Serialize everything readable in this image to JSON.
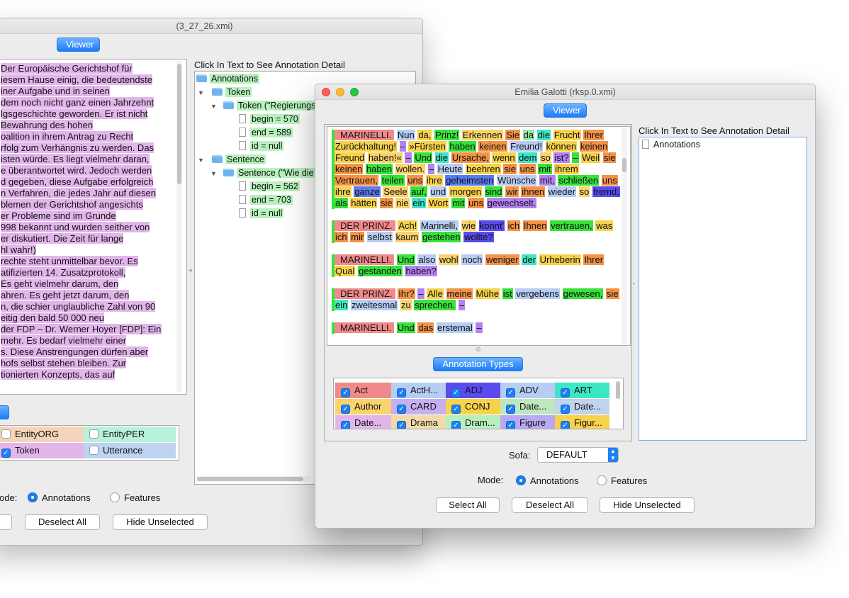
{
  "back_window": {
    "title": "(3_27_26.xmi)",
    "viewer_label": "Viewer",
    "detail_header": "Click In Text to See Annotation Detail",
    "text_lines": [
      "Der Europäische Gerichtshof für",
      "iesem Hause einig, die bedeutendste",
      "iner Aufgabe und in seinen",
      "dem noch nicht ganz einen Jahrzehnt",
      "lgsgeschichte geworden. Er ist nicht",
      " Bewahrung des hohen",
      "oalition in ihrem Antrag zu Recht",
      "rfolg zum Verhängnis zu werden. Das",
      "isten würde. Es liegt vielmehr daran,",
      "e überantwortet wird. Jedoch werden",
      "d gegeben, diese Aufgabe erfolgreich",
      "n Verfahren, die jedes Jahr auf diesen",
      "blemen der Gerichtshof angesichts",
      "er Probleme sind im Grunde",
      "998 bekannt und wurden seither von",
      "er diskutiert. Die Zeit für lange",
      "hl wahr!)",
      "rechte steht unmittelbar bevor. Es",
      "atifizierten 14. Zusatzprotokoll,",
      "Es geht vielmehr darum, den",
      "ahren. Es geht jetzt darum, den",
      "n, die schier unglaubliche Zahl von 90",
      "eitig den bald 50 000 neu",
      "der FDP – Dr. Werner Hoyer [FDP]: Eine",
      "",
      "mehr. Es bedarf vielmehr einer",
      "s. Diese Anstrengungen dürfen aber",
      "hofs selbst stehen bleiben. Zur",
      "tionierten Konzepts, das auf",
      ""
    ],
    "tree": {
      "root": "Annotations",
      "token_folder": "Token",
      "token_item": "Token (\"Regierungs",
      "token_begin": "begin = 570",
      "token_end": "end = 589",
      "token_id": "id = null",
      "sentence_folder": "Sentence",
      "sentence_item": "Sentence (\"Wie die",
      "sentence_begin": "begin = 562",
      "sentence_end": "end = 703",
      "sentence_id": "id = null"
    },
    "annotation_types_button": "s",
    "types": [
      {
        "label": "EntityORG",
        "checked": false,
        "color": "#f4d5bb"
      },
      {
        "label": "EntityPER",
        "checked": false,
        "color": "#b9f2dc"
      },
      {
        "label": "Token",
        "checked": true,
        "color": "#e2b6ea"
      },
      {
        "label": "Utterance",
        "checked": false,
        "color": "#bcd4f2"
      }
    ],
    "mode_label": "ode:",
    "mode_annotations": "Annotations",
    "mode_features": "Features",
    "deselect_all": "Deselect All",
    "hide_unselected": "Hide Unselected"
  },
  "front_window": {
    "title": "Emilia Galotti (rksp.0.xmi)",
    "viewer_label": "Viewer",
    "detail_header": "Click In Text to See Annotation Detail",
    "tree_root": "Annotations",
    "annotation_types_button": "Annotation Types",
    "paragraphs": [
      {
        "speaker": "MARINELLI.",
        "tokens": [
          {
            "t": "Nun",
            "c": "#b7cdf4"
          },
          {
            "t": "da,",
            "c": "#f7d24a"
          },
          {
            "t": "Prinz!",
            "c": "#38e23a"
          },
          {
            "t": "Erkennen",
            "c": "#f9d36b"
          },
          {
            "t": "Sie",
            "c": "#f39347"
          },
          {
            "t": "da",
            "c": "#9be8a0"
          },
          {
            "t": "die",
            "c": "#3de6c4"
          },
          {
            "t": "Frucht",
            "c": "#f7d24a"
          },
          {
            "t": "Ihrer",
            "c": "#f39347"
          },
          {
            "t": "Zurückhaltung!",
            "c": "#f7d24a"
          },
          {
            "t": "–",
            "c": "#b583f0"
          },
          {
            "t": "»Fürsten",
            "c": "#f7d24a"
          },
          {
            "t": "haben",
            "c": "#38e23a"
          },
          {
            "t": "keinen",
            "c": "#f39347"
          },
          {
            "t": "Freund!",
            "c": "#b7cdf4"
          },
          {
            "t": "können",
            "c": "#f7d24a"
          },
          {
            "t": "keinen",
            "c": "#f39347"
          },
          {
            "t": "Freund",
            "c": "#f7d24a"
          },
          {
            "t": "haben!«",
            "c": "#f9d36b"
          },
          {
            "t": "–",
            "c": "#b583f0"
          },
          {
            "t": "Und",
            "c": "#38e23a"
          },
          {
            "t": "die",
            "c": "#3de6c4"
          },
          {
            "t": "Ursache,",
            "c": "#f39347"
          },
          {
            "t": "wenn",
            "c": "#f7d24a"
          },
          {
            "t": "dem",
            "c": "#3de6c4"
          },
          {
            "t": "so",
            "c": "#f9d36b"
          },
          {
            "t": "ist?",
            "c": "#b583f0"
          },
          {
            "t": "–",
            "c": "#38e23a"
          },
          {
            "t": "Weil",
            "c": "#f7d24a"
          },
          {
            "t": "sie",
            "c": "#f39347"
          },
          {
            "t": "keinen",
            "c": "#f39347"
          },
          {
            "t": "haben",
            "c": "#38e23a"
          },
          {
            "t": "wollen.",
            "c": "#f9d36b"
          },
          {
            "t": "–",
            "c": "#b583f0"
          },
          {
            "t": "Heute",
            "c": "#b7cdf4"
          },
          {
            "t": "beehren",
            "c": "#f7d24a"
          },
          {
            "t": "sie",
            "c": "#f39347"
          },
          {
            "t": "uns",
            "c": "#f39347"
          },
          {
            "t": "mit",
            "c": "#38e23a"
          },
          {
            "t": "ihrem",
            "c": "#f7d24a"
          },
          {
            "t": "Vertrauen,",
            "c": "#f39347"
          },
          {
            "t": "teilen",
            "c": "#38e23a"
          },
          {
            "t": "uns",
            "c": "#f39347"
          },
          {
            "t": "ihre",
            "c": "#f7d24a"
          },
          {
            "t": "geheimsten",
            "c": "#5a7bf0"
          },
          {
            "t": "Wünsche",
            "c": "#b7cdf4"
          },
          {
            "t": "mit,",
            "c": "#b583f0"
          },
          {
            "t": "schließen",
            "c": "#38e23a"
          },
          {
            "t": "uns",
            "c": "#f39347"
          },
          {
            "t": "ihre",
            "c": "#f7d24a"
          },
          {
            "t": "ganze",
            "c": "#5a7bf0"
          },
          {
            "t": "Seele",
            "c": "#f9d36b"
          },
          {
            "t": "auf,",
            "c": "#38e23a"
          },
          {
            "t": "und",
            "c": "#b7cdf4"
          },
          {
            "t": "morgen",
            "c": "#f7d24a"
          },
          {
            "t": "sind",
            "c": "#38e23a"
          },
          {
            "t": "wir",
            "c": "#f39347"
          },
          {
            "t": "ihnen",
            "c": "#f39347"
          },
          {
            "t": "wieder",
            "c": "#b7cdf4"
          },
          {
            "t": "so",
            "c": "#f9d36b"
          },
          {
            "t": "fremd,",
            "c": "#5a4bf0"
          },
          {
            "t": "als",
            "c": "#38e23a"
          },
          {
            "t": "hätten",
            "c": "#f7d24a"
          },
          {
            "t": "sie",
            "c": "#f39347"
          },
          {
            "t": "nie",
            "c": "#f9d36b"
          },
          {
            "t": "ein",
            "c": "#3de6c4"
          },
          {
            "t": "Wort",
            "c": "#f7d24a"
          },
          {
            "t": "mit",
            "c": "#38e23a"
          },
          {
            "t": "uns",
            "c": "#f39347"
          },
          {
            "t": "gewechselt.",
            "c": "#b583f0"
          }
        ]
      },
      {
        "speaker": "DER PRINZ.",
        "tokens": [
          {
            "t": "Ach!",
            "c": "#f7d24a"
          },
          {
            "t": "Marinelli,",
            "c": "#b7cdf4"
          },
          {
            "t": "wie",
            "c": "#f9d36b"
          },
          {
            "t": "konnt'",
            "c": "#5a4bf0"
          },
          {
            "t": "ich",
            "c": "#f39347"
          },
          {
            "t": "Ihnen",
            "c": "#f39347"
          },
          {
            "t": "vertrauen,",
            "c": "#38e23a"
          },
          {
            "t": "was",
            "c": "#f7d24a"
          },
          {
            "t": "ich",
            "c": "#f39347"
          },
          {
            "t": "mir",
            "c": "#f39347"
          },
          {
            "t": "selbst",
            "c": "#b7cdf4"
          },
          {
            "t": "kaum",
            "c": "#f9d36b"
          },
          {
            "t": "gestehen",
            "c": "#38e23a"
          },
          {
            "t": "wollte?",
            "c": "#5a4bf0"
          }
        ]
      },
      {
        "speaker": "MARINELLI.",
        "tokens": [
          {
            "t": "Und",
            "c": "#38e23a"
          },
          {
            "t": "also",
            "c": "#b7cdf4"
          },
          {
            "t": "wohl",
            "c": "#f9d36b"
          },
          {
            "t": "noch",
            "c": "#b7cdf4"
          },
          {
            "t": "weniger",
            "c": "#f39347"
          },
          {
            "t": "der",
            "c": "#3de6c4"
          },
          {
            "t": "Urheberin",
            "c": "#f7d24a"
          },
          {
            "t": "Ihrer",
            "c": "#f39347"
          },
          {
            "t": "Qual",
            "c": "#f7d24a"
          },
          {
            "t": "gestanden",
            "c": "#38e23a"
          },
          {
            "t": "haben?",
            "c": "#b583f0"
          }
        ]
      },
      {
        "speaker": "DER PRINZ.",
        "tokens": [
          {
            "t": "Ihr?",
            "c": "#f39347"
          },
          {
            "t": "–",
            "c": "#b583f0"
          },
          {
            "t": "Alle",
            "c": "#f7d24a"
          },
          {
            "t": "meine",
            "c": "#f39347"
          },
          {
            "t": "Mühe",
            "c": "#f7d24a"
          },
          {
            "t": "ist",
            "c": "#38e23a"
          },
          {
            "t": "vergebens",
            "c": "#b7cdf4"
          },
          {
            "t": "gewesen,",
            "c": "#38e23a"
          },
          {
            "t": "sie",
            "c": "#f39347"
          },
          {
            "t": "ein",
            "c": "#3de6c4"
          },
          {
            "t": "zweitesmal",
            "c": "#b7cdf4"
          },
          {
            "t": "zu",
            "c": "#f9d36b"
          },
          {
            "t": "sprechen.",
            "c": "#38e23a"
          },
          {
            "t": "–",
            "c": "#b583f0"
          }
        ]
      },
      {
        "speaker": "MARINELLI.",
        "tokens": [
          {
            "t": "Und",
            "c": "#38e23a"
          },
          {
            "t": "das",
            "c": "#f39347"
          },
          {
            "t": "erstemal",
            "c": "#b7cdf4"
          },
          {
            "t": "–",
            "c": "#b583f0"
          }
        ]
      }
    ],
    "types": [
      {
        "label": "Act",
        "checked": true,
        "color": "#f08a8a"
      },
      {
        "label": "ActH...",
        "checked": true,
        "color": "#b7cdf4"
      },
      {
        "label": "ADJ",
        "checked": true,
        "color": "#5a4bf0"
      },
      {
        "label": "ADV",
        "checked": true,
        "color": "#b7cdf4"
      },
      {
        "label": "ART",
        "checked": true,
        "color": "#3de6c4"
      },
      {
        "label": "Author",
        "checked": true,
        "color": "#f9d36b"
      },
      {
        "label": "CARD",
        "checked": true,
        "color": "#c5b0f0"
      },
      {
        "label": "CONJ",
        "checked": true,
        "color": "#f7d24a"
      },
      {
        "label": "Date...",
        "checked": true,
        "color": "#bde8bd"
      },
      {
        "label": "Date...",
        "checked": true,
        "color": "#c0d3ef"
      },
      {
        "label": "Date...",
        "checked": true,
        "color": "#e2b6ea"
      },
      {
        "label": "Drama",
        "checked": true,
        "color": "#f2dba8"
      },
      {
        "label": "Dram...",
        "checked": true,
        "color": "#b8f0bd"
      },
      {
        "label": "Figure",
        "checked": true,
        "color": "#b9a8f2"
      },
      {
        "label": "Figur...",
        "checked": true,
        "color": "#f7d24a"
      }
    ],
    "sofa_label": "Sofa:",
    "sofa_value": "DEFAULT",
    "mode_label": "Mode:",
    "mode_annotations": "Annotations",
    "mode_features": "Features",
    "select_all": "Select All",
    "deselect_all": "Deselect All",
    "hide_unselected": "Hide Unselected"
  }
}
